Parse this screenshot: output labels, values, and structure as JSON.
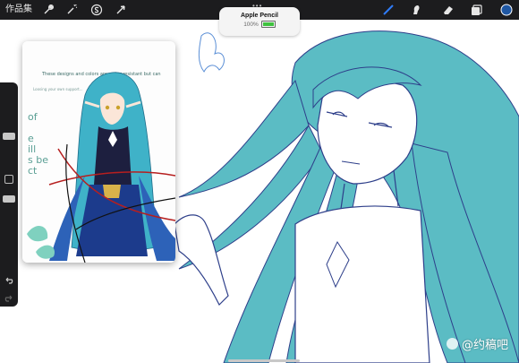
{
  "topbar": {
    "gallery_label": "作品集",
    "left_tools": [
      "wrench-icon",
      "magic-wand-icon",
      "selection-s-icon",
      "transform-arrow-icon"
    ],
    "right_tools": [
      "brush-icon",
      "smudge-icon",
      "eraser-icon",
      "layers-icon"
    ],
    "active_color": "#1f57a3",
    "accent_tool": "brush-icon"
  },
  "pencil_popup": {
    "title": "Apple Pencil",
    "battery": "100%",
    "battery_color": "#3ec23e"
  },
  "sidebar": {
    "icons": [
      "brush-size-slider",
      "modify-square-icon",
      "opacity-slider",
      "undo-icon",
      "redo-icon"
    ]
  },
  "reference_window": {
    "handwriting": [
      "These designs and colors are water resistant but can",
      "Loosing your own support...",
      "of",
      "e",
      "ill",
      "s be",
      "ct"
    ]
  },
  "watermark": {
    "text": "@约稿吧"
  },
  "colors": {
    "hair": "#5bbcc4",
    "line": "#2e3f8a"
  }
}
